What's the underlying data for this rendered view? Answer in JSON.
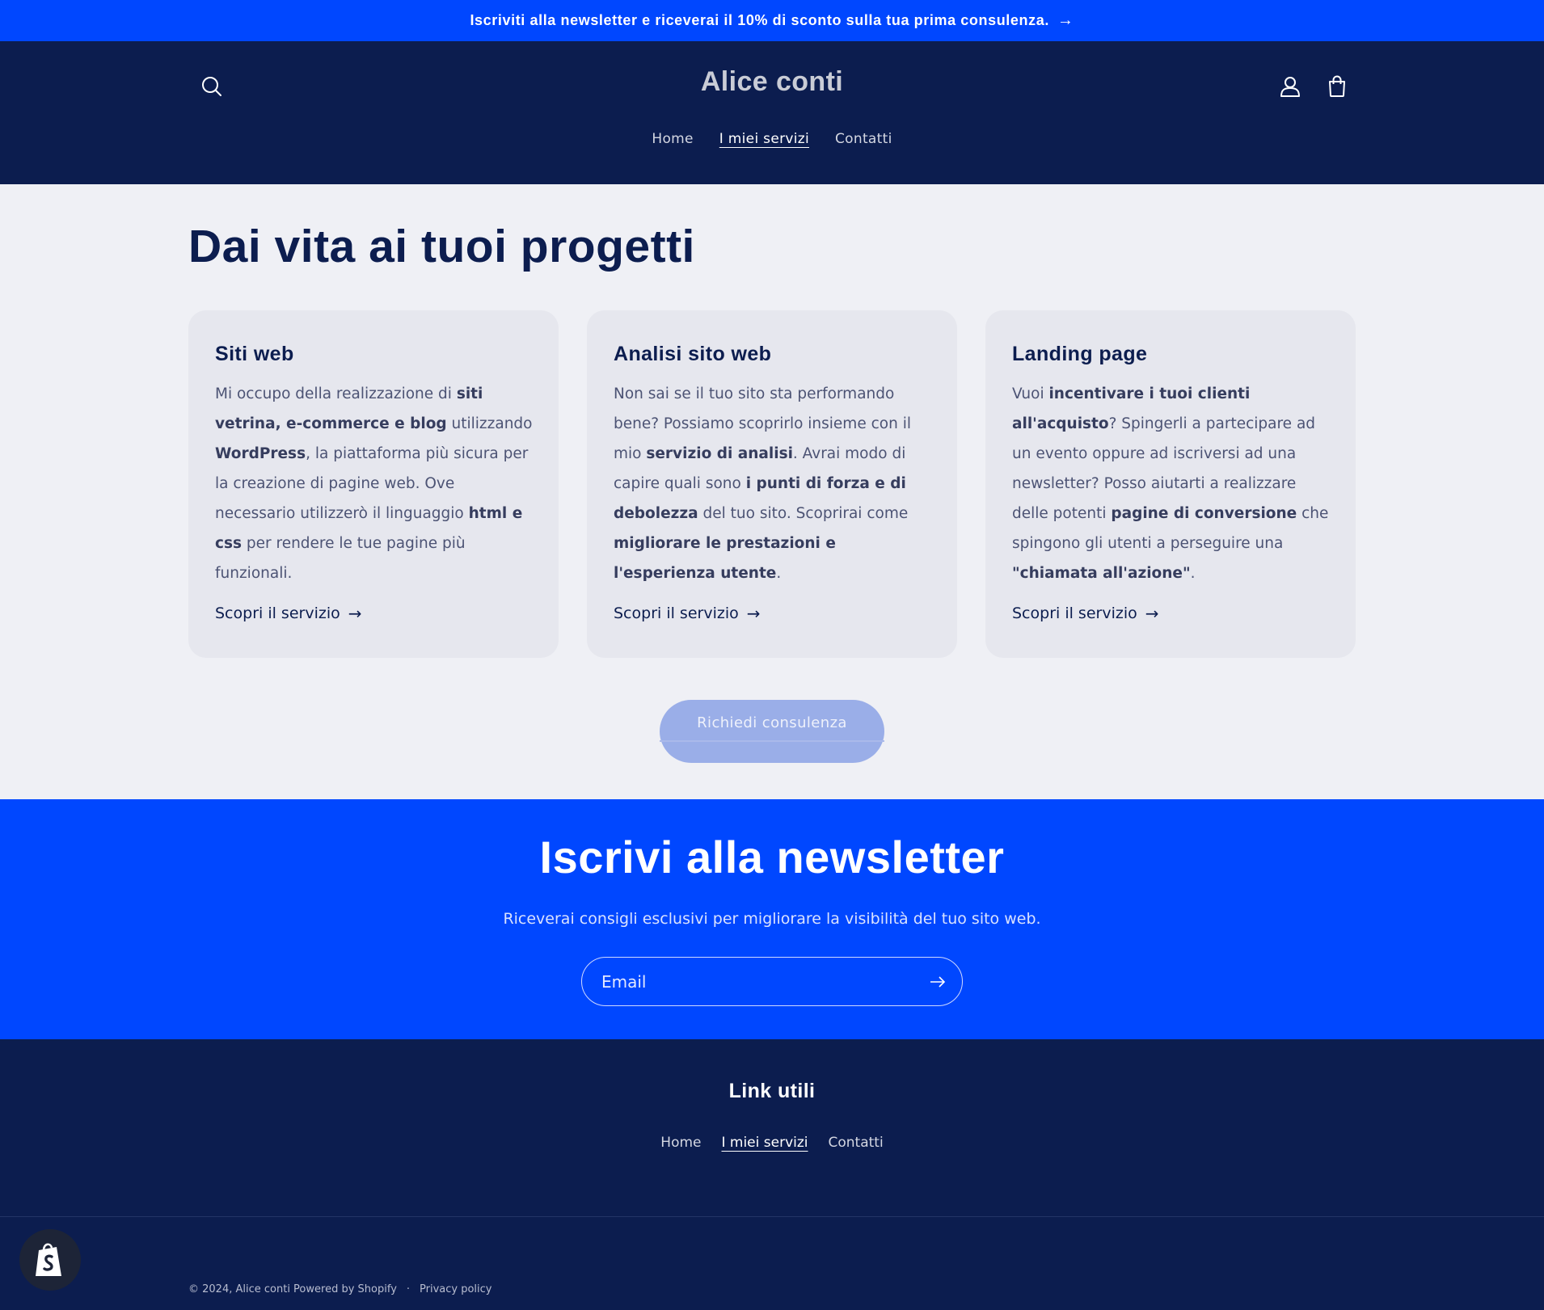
{
  "announcement": {
    "text": "Iscriviti alla newsletter e riceverai il 10% di sconto sulla tua prima consulenza.",
    "arrow": "→"
  },
  "header": {
    "logo": "Alice conti",
    "nav": [
      {
        "label": "Home"
      },
      {
        "label": "I miei servizi",
        "active": true
      },
      {
        "label": "Contatti"
      }
    ],
    "icons": [
      "search-icon",
      "account-icon",
      "cart-icon"
    ]
  },
  "main": {
    "title": "Dai vita ai tuoi progetti",
    "cards": [
      {
        "title": "Siti web",
        "body": [
          {
            "t": "Mi occupo della realizzazione di "
          },
          {
            "t": "siti vetrina, e-commerce e blog",
            "b": true
          },
          {
            "t": " utilizzando "
          },
          {
            "t": "WordPress",
            "b": true
          },
          {
            "t": ", la piattaforma più sicura per la creazione di pagine web. Ove necessario utilizzerò il linguaggio "
          },
          {
            "t": "html e css",
            "b": true
          },
          {
            "t": " per rendere le tue pagine più funzionali."
          }
        ],
        "link": "Scopri il servizio"
      },
      {
        "title": "Analisi sito web",
        "body": [
          {
            "t": "Non sai se il tuo sito sta performando bene? Possiamo scoprirlo insieme con il mio "
          },
          {
            "t": "servizio di analisi",
            "b": true
          },
          {
            "t": ". Avrai modo di capire quali sono "
          },
          {
            "t": "i punti di forza e di debolezza",
            "b": true
          },
          {
            "t": " del tuo sito. Scoprirai come "
          },
          {
            "t": "migliorare le prestazioni e l'esperienza utente",
            "b": true
          },
          {
            "t": "."
          }
        ],
        "link": "Scopri il servizio"
      },
      {
        "title": "Landing page",
        "body": [
          {
            "t": "Vuoi "
          },
          {
            "t": "incentivare i tuoi clienti all'acquisto",
            "b": true
          },
          {
            "t": "? Spingerli a partecipare ad un evento oppure ad iscriversi ad una newsletter? Posso aiutarti a realizzare delle potenti "
          },
          {
            "t": "pagine di conversione",
            "b": true
          },
          {
            "t": " che spingono gli utenti a perseguire una "
          },
          {
            "t": "\"chiamata all'azione\"",
            "b": true
          },
          {
            "t": "."
          }
        ],
        "link": "Scopri il servizio"
      }
    ],
    "cta": "Richiedi consulenza"
  },
  "newsletter": {
    "title": "Iscrivi alla newsletter",
    "subtitle": "Riceverai consigli esclusivi per migliorare la visibilità del tuo sito web.",
    "email_placeholder": "Email"
  },
  "footer": {
    "title": "Link utili",
    "nav": [
      {
        "label": "Home"
      },
      {
        "label": "I miei servizi",
        "active": true
      },
      {
        "label": "Contatti"
      }
    ],
    "copyright": "© 2024, Alice conti Powered by Shopify",
    "separator": "·",
    "privacy": "Privacy policy"
  },
  "colors": {
    "primary_blue": "#0047ff",
    "navy": "#0c1d4f",
    "background": "#eff0f5",
    "card": "#e6e7ee"
  }
}
